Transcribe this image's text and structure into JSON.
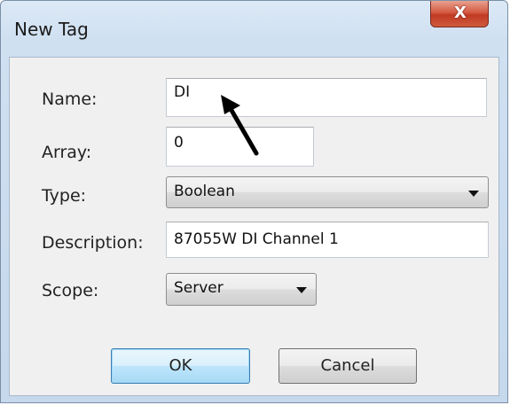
{
  "window": {
    "title": "New Tag",
    "close_glyph": "X"
  },
  "form": {
    "name": {
      "label": "Name:",
      "value": "DI"
    },
    "array": {
      "label": "Array:",
      "value": "0"
    },
    "type": {
      "label": "Type:",
      "selected": "Boolean"
    },
    "description": {
      "label": "Description:",
      "value": "87055W DI Channel 1"
    },
    "scope": {
      "label": "Scope:",
      "selected": "Server"
    }
  },
  "buttons": {
    "ok": "OK",
    "cancel": "Cancel"
  },
  "icons": {
    "close": "close-icon",
    "dropdown": "chevron-down-icon",
    "annotation": "arrow-pointer-icon"
  },
  "colors": {
    "title_frame": "#c5d8ec",
    "close_button": "#c03a22",
    "client_area": "#f0f0f0",
    "default_button": "#bee6fd"
  }
}
